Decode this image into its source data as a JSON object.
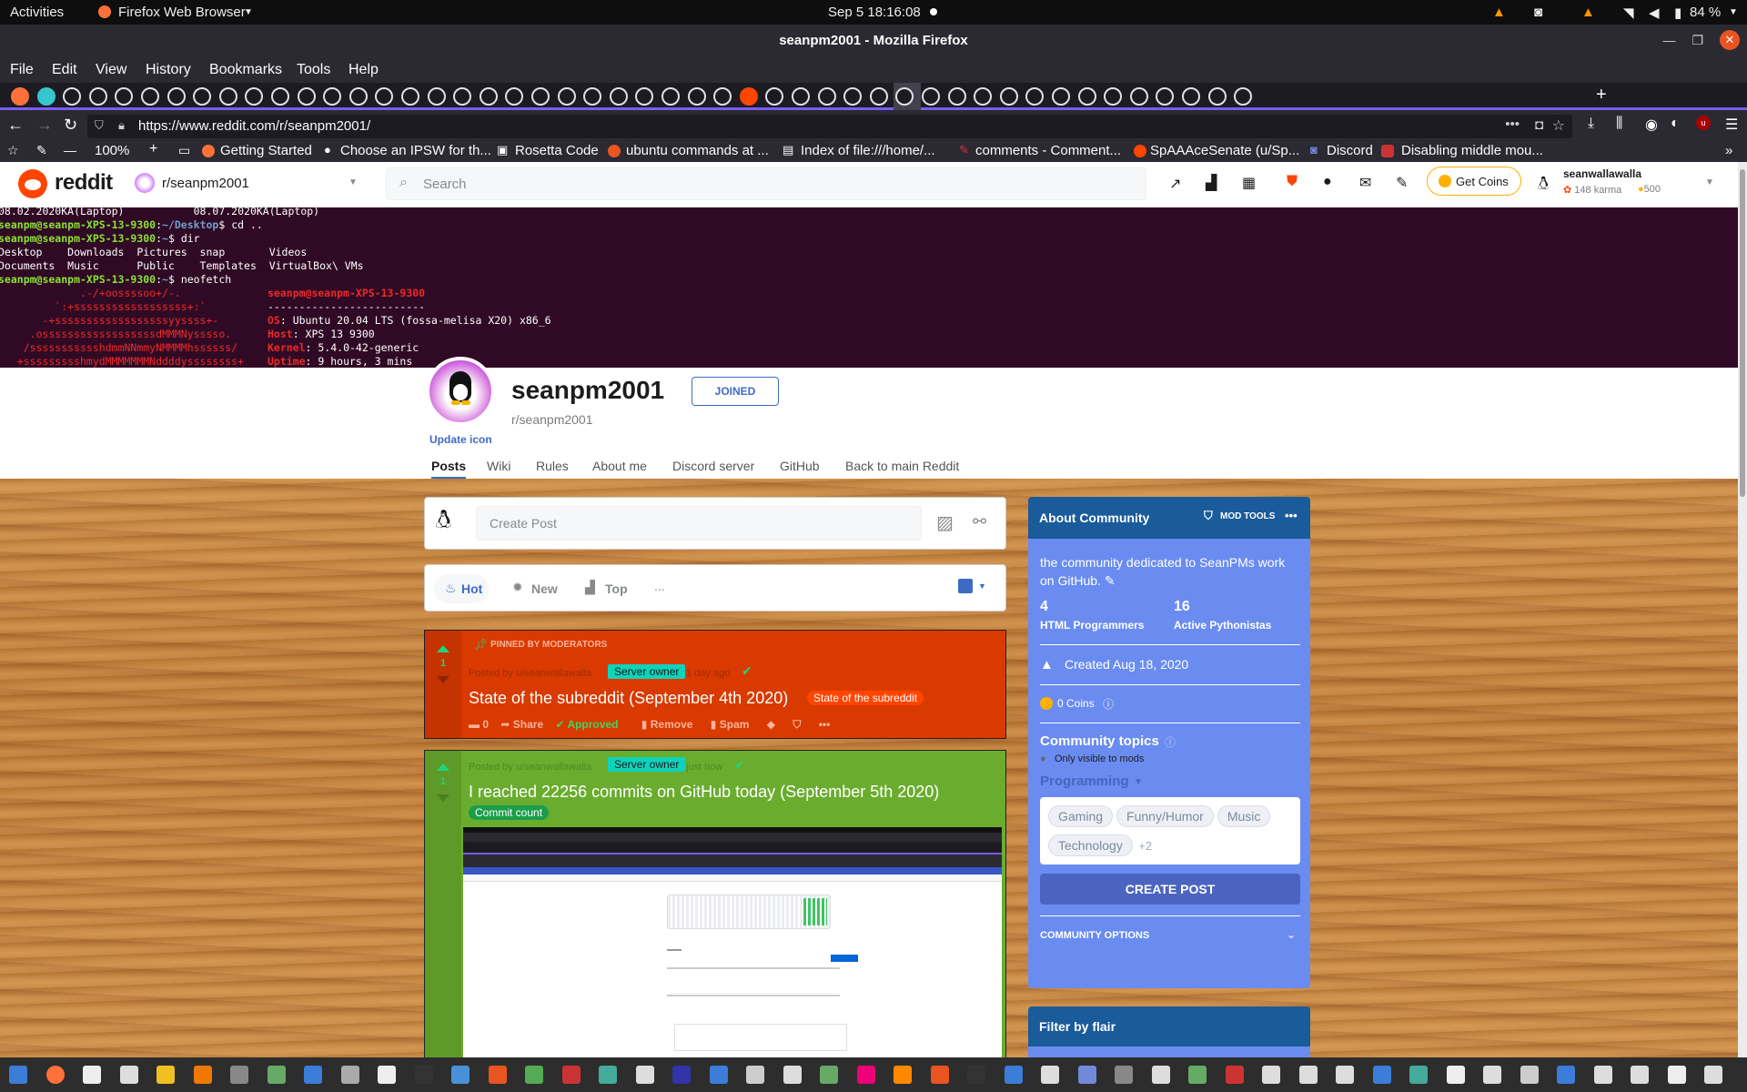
{
  "topbar": {
    "activities": "Activities",
    "app_name": "Firefox Web Browser",
    "clock": "Sep 5  18:16:08",
    "battery": "84 %"
  },
  "window": {
    "title": "seanpm2001 - Mozilla Firefox"
  },
  "menu": [
    "File",
    "Edit",
    "View",
    "History",
    "Bookmarks",
    "Tools",
    "Help"
  ],
  "nav": {
    "url": "https://www.reddit.com/r/seanpm2001/",
    "zoom": "100%"
  },
  "bookmarks": [
    "Getting Started",
    "Choose an IPSW for th...",
    "Rosetta Code",
    "ubuntu commands at ...",
    "Index of file:///home/...",
    "comments - Comment...",
    "SpAAAceSenate (u/Sp...",
    "Discord",
    "Disabling middle mou..."
  ],
  "reddit_header": {
    "wordmark": "reddit",
    "community": "r/seanpm2001",
    "search_placeholder": "Search",
    "get_coins": "Get Coins",
    "username": "seanwallawalla",
    "karma": "148 karma",
    "coins": "500"
  },
  "terminal": {
    "lines": [
      "08.02.2020KA(Laptop)           08.07.2020KA(Laptop)",
      "seanpm@seanpm-XPS-13-9300:~/Desktop$ cd ..",
      "seanpm@seanpm-XPS-13-9300:~$ dir",
      "Desktop    Downloads  Pictures  snap       Videos",
      "Documents  Music      Public    Templates  VirtualBox\\ VMs",
      "seanpm@seanpm-XPS-13-9300:~$ neofetch"
    ],
    "host_title": "seanpm@seanpm-XPS-13-9300",
    "separator": "-------------------------",
    "os_label": "OS",
    "os_value": ": Ubuntu 20.04 LTS (fossa-melisa X20) x86_6",
    "host_label": "Host",
    "host_value": ": XPS 13 9300",
    "kernel_label": "Kernel",
    "kernel_value": ": 5.4.0-42-generic",
    "uptime_label": "Uptime",
    "uptime_value": ": 9 hours, 3 mins",
    "ascii": [
      "             .-/+oossssoo+/-.",
      "         `:+ssssssssssssssssss+:`",
      "       -+ssssssssssssssssssyyssss+-",
      "     .ossssssssssssssssssdMMMNysssso.",
      "    /ssssssssssshdmmNNmmyNMMMMhssssss/",
      "   +ssssssssshmydMMMMMMMNddddyssssssss+"
    ]
  },
  "subreddit": {
    "name": "seanpm2001",
    "handle": "r/seanpm2001",
    "joined": "JOINED",
    "update_icon": "Update icon",
    "tabs": [
      "Posts",
      "Wiki",
      "Rules",
      "About me",
      "Discord server",
      "GitHub",
      "Back to main Reddit"
    ]
  },
  "create_post": {
    "placeholder": "Create Post"
  },
  "sort": {
    "hot": "Hot",
    "new": "New",
    "top": "Top",
    "more": "..."
  },
  "posts": [
    {
      "pinned": "PINNED BY MODERATORS",
      "posted_by": "Posted by u/seanwallawalla",
      "flair_user": "Server owner",
      "age": "1 day ago",
      "votes": "1",
      "title": "State of the subreddit (September 4th 2020)",
      "flair": "State of the subreddit",
      "comments": "0",
      "share": "Share",
      "approved": "Approved",
      "remove": "Remove",
      "spam": "Spam",
      "bg": "#d93a00"
    },
    {
      "posted_by": "Posted by u/seanwallawalla",
      "flair_user": "Server owner",
      "age": "just now",
      "votes": "1",
      "title": "I reached 22256 commits on GitHub today (September 5th 2020)",
      "flair": "Commit count",
      "bg": "#6aad2e"
    }
  ],
  "sidebar": {
    "about_title": "About Community",
    "mod_tools": "MOD TOOLS",
    "description": "the community dedicated to SeanPMs work on GitHub.",
    "members": "4",
    "members_label": "HTML Programmers",
    "online": "16",
    "online_label": "Active Pythonistas",
    "created": "Created Aug 18, 2020",
    "coins": "0 Coins",
    "topics_title": "Community topics",
    "topics_note": "Only visible to mods",
    "primary_topic": "Programming",
    "topics": [
      "Gaming",
      "Funny/Humor",
      "Music",
      "Technology"
    ],
    "more_topics": "+2",
    "create_post": "CREATE POST",
    "community_options": "COMMUNITY OPTIONS",
    "filter_title": "Filter by flair"
  },
  "colors": {
    "reddit_orange": "#ff4500",
    "sidebar_blue": "#6a8cf0",
    "header_blue": "#1a5b9b",
    "post_red": "#d93a00",
    "post_green": "#6aad2e",
    "flair_teal": "#0dd3bb"
  }
}
